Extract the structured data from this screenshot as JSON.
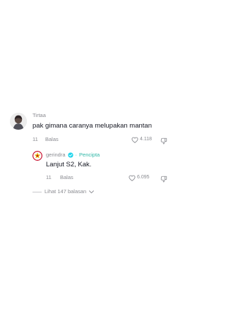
{
  "comments": [
    {
      "username": "Tirtaa",
      "text": "pak gimana caranya melupakan mantan",
      "timestamp": "11",
      "reply_label": "Balas",
      "likes": "4.118"
    }
  ],
  "reply": {
    "username": "gerindra",
    "creator_label": "Pencipta",
    "separator": "·",
    "text": "Lanjut S2, Kak.",
    "timestamp": "11",
    "reply_label": "Balas",
    "likes": "6.095"
  },
  "view_replies_label": "Lihat 147 balasan",
  "colors": {
    "accent": "#2fb7a7",
    "text": "#161823",
    "muted": "#8a8b91",
    "logo_red": "#c8102e",
    "logo_gold": "#e5b400"
  }
}
